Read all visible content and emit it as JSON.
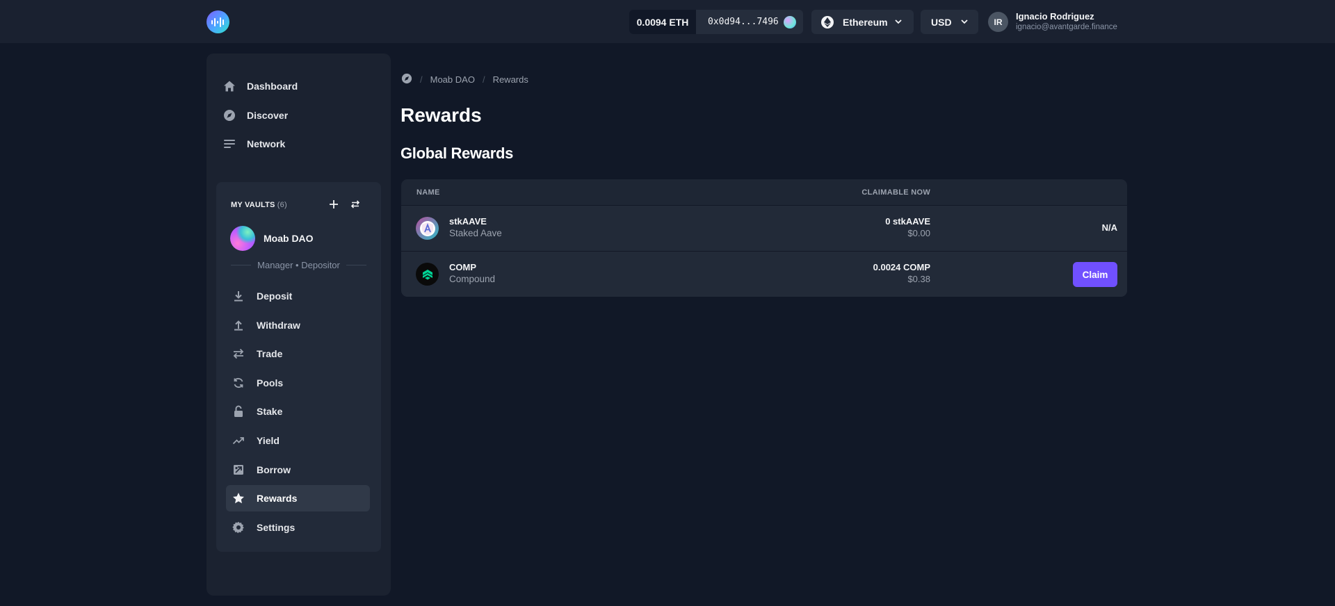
{
  "topbar": {
    "eth_balance": "0.0094 ETH",
    "wallet_address": "0x0d94...7496",
    "network": "Ethereum",
    "currency": "USD",
    "user": {
      "initials": "IR",
      "name": "Ignacio Rodriguez",
      "email": "ignacio@avantgarde.finance"
    }
  },
  "sidebar": {
    "nav": [
      {
        "label": "Dashboard",
        "icon": "home-icon"
      },
      {
        "label": "Discover",
        "icon": "compass-icon"
      },
      {
        "label": "Network",
        "icon": "list-icon"
      }
    ],
    "vaults": {
      "heading": "MY VAULTS",
      "count": "(6)",
      "current_vault": "Moab DAO",
      "role": "Manager • Depositor",
      "items": [
        {
          "label": "Deposit",
          "icon": "download-icon"
        },
        {
          "label": "Withdraw",
          "icon": "upload-icon"
        },
        {
          "label": "Trade",
          "icon": "swap-icon"
        },
        {
          "label": "Pools",
          "icon": "refresh-icon"
        },
        {
          "label": "Stake",
          "icon": "unlock-icon"
        },
        {
          "label": "Yield",
          "icon": "trending-up-icon"
        },
        {
          "label": "Borrow",
          "icon": "borrow-icon"
        },
        {
          "label": "Rewards",
          "icon": "star-icon",
          "active": true
        },
        {
          "label": "Settings",
          "icon": "gear-icon"
        }
      ]
    }
  },
  "main": {
    "breadcrumb": [
      "Moab DAO",
      "Rewards"
    ],
    "title": "Rewards",
    "section_title": "Global Rewards",
    "table": {
      "columns": [
        "NAME",
        "CLAIMABLE NOW"
      ],
      "rows": [
        {
          "symbol": "stkAAVE",
          "name": "Staked Aave",
          "amount": "0 stkAAVE",
          "usd": "$0.00",
          "action": "N/A"
        },
        {
          "symbol": "COMP",
          "name": "Compound",
          "amount": "0.0024 COMP",
          "usd": "$0.38",
          "action": "Claim"
        }
      ]
    }
  },
  "colors": {
    "accent": "#7050ff",
    "background": "#111827",
    "panel": "#1b2230"
  }
}
